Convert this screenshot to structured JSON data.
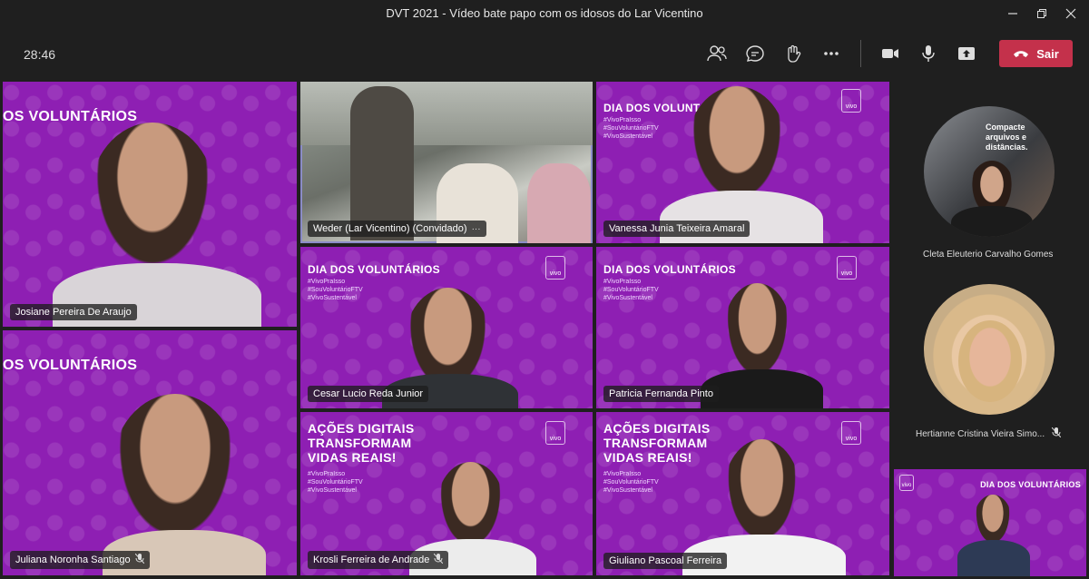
{
  "window": {
    "title": "DVT 2021 - Vídeo bate papo com os idosos do Lar Vicentino"
  },
  "toolbar": {
    "timer": "28:46",
    "leave_label": "Sair"
  },
  "banners": {
    "voluntarios": "DIA DOS VOLUNTÁRIOS",
    "voluntarios_cut": "OS VOLUNTÁRIOS",
    "acoes_line1": "AÇÕES DIGITAIS",
    "acoes_line2": "TRANSFORMAM",
    "acoes_line3": "VIDAS REAIS!",
    "hashtag1": "#VivoPraIsso",
    "hashtag2": "#SouVoluntárioFTV",
    "hashtag3": "#VivoSustentável",
    "brand": "vivo"
  },
  "participants": [
    {
      "name": "Josiane Pereira De Araujo",
      "muted": false
    },
    {
      "name": "Weder (Lar Vicentino) (Convidado)",
      "muted": false,
      "more": "···"
    },
    {
      "name": "Vanessa Junia Teixeira Amaral",
      "muted": false
    },
    {
      "name": "Cesar Lucio Reda Junior",
      "muted": false
    },
    {
      "name": "Patricia Fernanda Pinto",
      "muted": false
    },
    {
      "name": "Juliana Noronha Santiago",
      "muted": true
    },
    {
      "name": "Krosli Ferreira de Andrade",
      "muted": true
    },
    {
      "name": "Giuliano Pascoal Ferreira",
      "muted": false
    }
  ],
  "sidebar": [
    {
      "name": "Cleta Eleuterio Carvalho Gomes",
      "muted": false,
      "bg_text": "Compacte arquivos e distâncias."
    },
    {
      "name": "Hertianne Cristina Vieira Simo...",
      "muted": true
    }
  ],
  "self_view": {
    "banner": "DIA DOS VOLUNTÁRIOS"
  },
  "colors": {
    "brand_purple": "#8e1fb3",
    "leave_red": "#c4314b",
    "bg": "#1f1f1f"
  },
  "icons": [
    "people-icon",
    "chat-icon",
    "raise-hand-icon",
    "more-icon",
    "camera-icon",
    "mic-icon",
    "share-icon",
    "phone-hangup-icon",
    "mic-off-icon"
  ]
}
